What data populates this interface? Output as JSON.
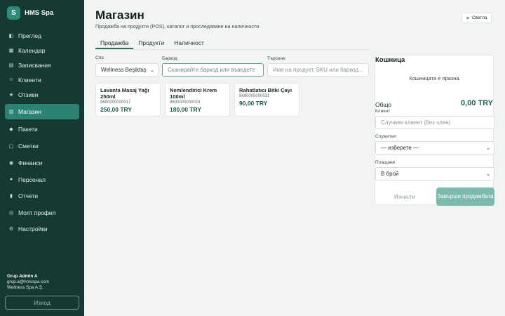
{
  "brand": {
    "logo_letter": "S",
    "name": "HMS Spa"
  },
  "nav": [
    {
      "icon": "◧",
      "label": "Преглед"
    },
    {
      "icon": "▦",
      "label": "Календар"
    },
    {
      "icon": "▤",
      "label": "Записвания"
    },
    {
      "icon": "☺",
      "label": "Клиенти"
    },
    {
      "icon": "★",
      "label": "Отзиви"
    },
    {
      "icon": "▥",
      "label": "Магазин",
      "active": true
    },
    {
      "icon": "◆",
      "label": "Пакети"
    },
    {
      "icon": "▢",
      "label": "Сметки"
    },
    {
      "icon": "◉",
      "label": "Финанси"
    },
    {
      "icon": "●",
      "label": "Персонал"
    },
    {
      "icon": "▮",
      "label": "Отчети"
    },
    {
      "icon": "◎",
      "label": "Моят профил"
    },
    {
      "icon": "⚙",
      "label": "Настройки"
    }
  ],
  "user": {
    "name": "Grup Admin A",
    "email": "grup.a@hmsspa.com",
    "company": "Wellness Spa A.Ş."
  },
  "logout_label": "Изход",
  "page": {
    "title": "Магазин",
    "subtitle": "Продажба на продукти (POS), каталог и проследяване на наличности",
    "theme_label": "Светла",
    "tabs": [
      "Продажба",
      "Продукти",
      "Наличност"
    ]
  },
  "filters": {
    "spa_label": "Спа",
    "spa_value": "Wellness Beşiktaş",
    "barcode_label": "Баркод",
    "barcode_placeholder": "Сканирайте баркод или въведете",
    "search_label": "Търсене",
    "search_placeholder": "Име на продукт, SKU или баркод..."
  },
  "products": [
    {
      "name": "Lavanta Masaj Yağı 250ml",
      "sku": "8690000000017",
      "price": "250,00 TRY"
    },
    {
      "name": "Nemlendirici Krem 100ml",
      "sku": "8690000000024",
      "price": "180,00 TRY"
    },
    {
      "name": "Rahatlatıcı Bitki Çayı",
      "sku": "8690000000031",
      "price": "90,00 TRY"
    }
  ],
  "cart": {
    "title": "Кошница",
    "empty_text": "Кошницата е празна.",
    "total_label": "Общо",
    "total_value": "0,00 TRY",
    "client_label": "Клиент",
    "client_placeholder": "Случаен клиент (без член)",
    "employee_label": "Служител",
    "employee_value": "— изберете —",
    "payment_label": "Плащане",
    "payment_value": "В брой",
    "clear_label": "Изчисти",
    "finish_label": "Завърши продажбата"
  }
}
